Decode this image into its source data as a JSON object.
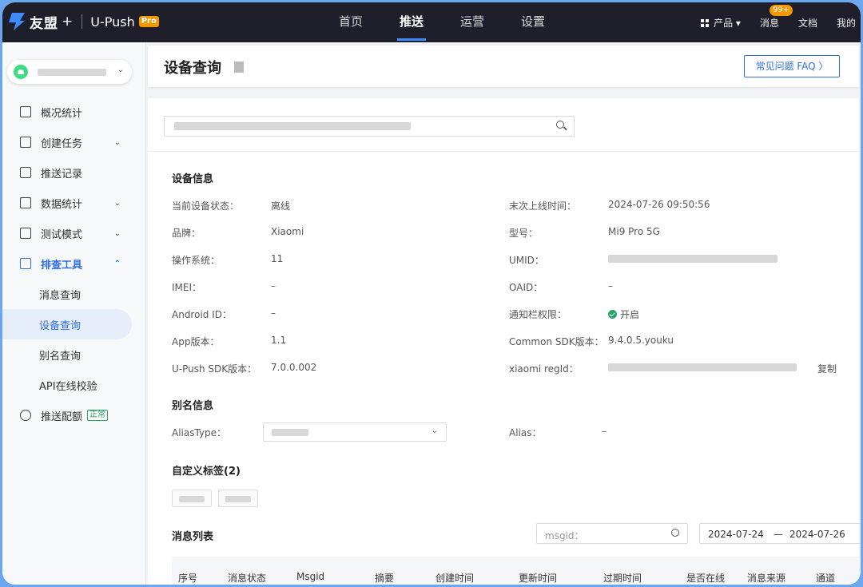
{
  "topbar": {
    "brand": "友盟",
    "plus": "+",
    "product": "U-Push",
    "pro": "Pro",
    "nav": [
      "首页",
      "推送",
      "运营",
      "设置"
    ],
    "active_nav": "推送",
    "product_menu": "产品 ▾",
    "messages": "消息",
    "messages_badge": "99+",
    "docs": "文档",
    "mine": "我的"
  },
  "sidebar": {
    "items": [
      {
        "label": "概况统计",
        "icon": "chart-icon"
      },
      {
        "label": "创建任务",
        "icon": "task-icon",
        "arrow": "⌄"
      },
      {
        "label": "推送记录",
        "icon": "record-icon"
      },
      {
        "label": "数据统计",
        "icon": "stats-icon",
        "arrow": "⌄"
      },
      {
        "label": "测试模式",
        "icon": "test-icon",
        "arrow": "⌄"
      },
      {
        "label": "排查工具",
        "icon": "tools-icon",
        "arrow": "⌃"
      }
    ],
    "sub_items": [
      "消息查询",
      "设备查询",
      "别名查询",
      "API在线校验"
    ],
    "quota": {
      "label": "推送配额",
      "status": "正常"
    }
  },
  "page": {
    "title": "设备查询",
    "faq": "常见问题 FAQ  〉",
    "device_section": "设备信息",
    "left": [
      {
        "k": "当前设备状态：",
        "v": "离线"
      },
      {
        "k": "品牌：",
        "v": "Xiaomi"
      },
      {
        "k": "操作系统：",
        "v": "11"
      },
      {
        "k": "IMEI：",
        "v": "–"
      },
      {
        "k": "Android ID：",
        "v": "–"
      },
      {
        "k": "App版本：",
        "v": "1.1"
      },
      {
        "k": "U-Push SDK版本：",
        "v": "7.0.0.002"
      }
    ],
    "right": [
      {
        "k": "末次上线时间：",
        "v": "2024-07-26 09:50:56"
      },
      {
        "k": "型号：",
        "v": "Mi9 Pro 5G"
      },
      {
        "k": "UMID：",
        "v": ""
      },
      {
        "k": "OAID：",
        "v": "–"
      },
      {
        "k": "通知栏权限：",
        "v": "开启"
      },
      {
        "k": "Common SDK版本：",
        "v": "9.4.0.5.youku"
      },
      {
        "k": "xiaomi regId：",
        "v": ""
      }
    ],
    "copy": "复制",
    "alias_section": "别名信息",
    "alias_type_label": "AliasType：",
    "alias_label": "Alias：",
    "alias_value": "–",
    "tags_section": "自定义标签(2)",
    "msg_section": "消息列表",
    "msgid_placeholder": "msgid：",
    "date_from": "2024-07-24",
    "date_sep": "—",
    "date_to": "2024-07-26",
    "columns": [
      "序号",
      "消息状态",
      "Msgid",
      "摘要",
      "创建时间",
      "更新时间",
      "过期时间",
      "是否在线",
      "消息来源",
      "通道"
    ]
  }
}
